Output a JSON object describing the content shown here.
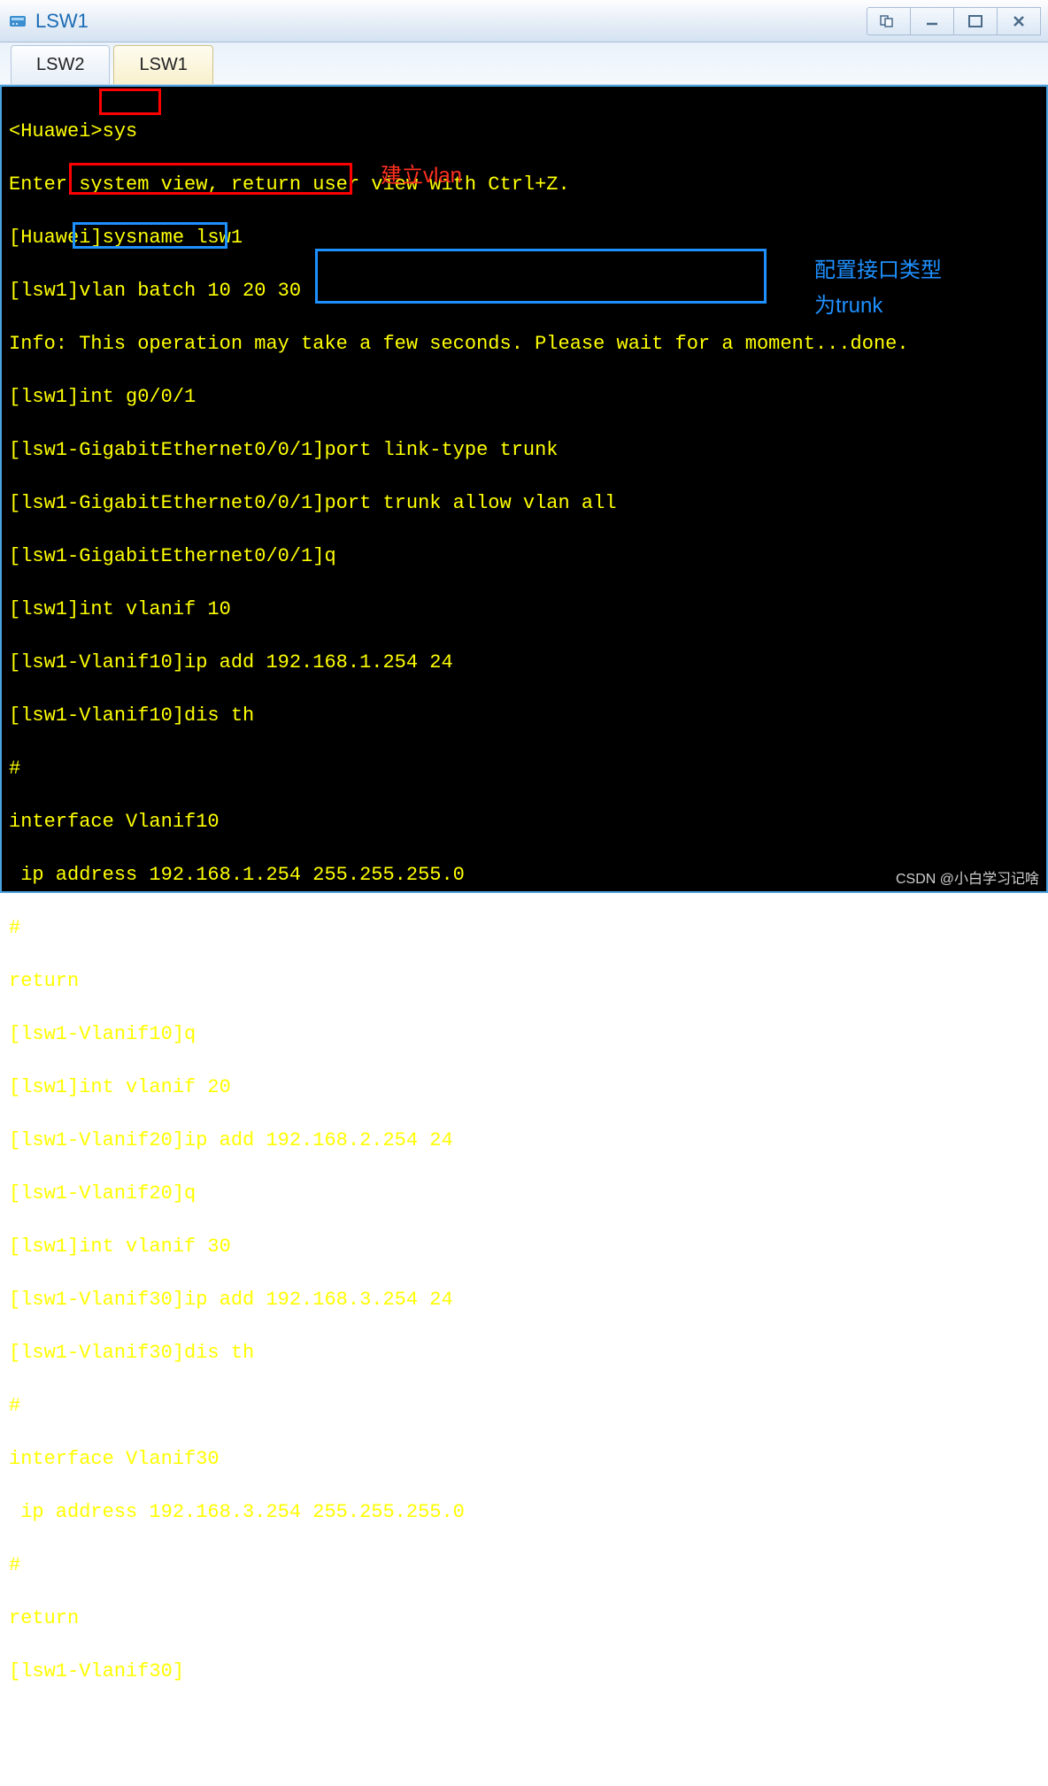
{
  "window": {
    "title": "LSW1"
  },
  "tabs": [
    {
      "label": "LSW2",
      "active": false
    },
    {
      "label": "LSW1",
      "active": true
    }
  ],
  "annotations": {
    "vlan_label": "建立vlan",
    "trunk_label_line1": "配置接口类型",
    "trunk_label_line2": "为trunk"
  },
  "terminal_lines": {
    "l0": "<Huawei>sys",
    "l1": "Enter system view, return user view with Ctrl+Z.",
    "l2": "[Huawei]sysname lsw1",
    "l3": "[lsw1]vlan batch 10 20 30",
    "l4": "Info: This operation may take a few seconds. Please wait for a moment...done.",
    "l5": "[lsw1]int g0/0/1",
    "l6": "[lsw1-GigabitEthernet0/0/1]port link-type trunk",
    "l7": "[lsw1-GigabitEthernet0/0/1]port trunk allow vlan all",
    "l8": "[lsw1-GigabitEthernet0/0/1]q",
    "l9": "[lsw1]int vlanif 10",
    "l10": "[lsw1-Vlanif10]ip add 192.168.1.254 24",
    "l11": "[lsw1-Vlanif10]dis th",
    "l12": "#",
    "l13": "interface Vlanif10",
    "l14": " ip address 192.168.1.254 255.255.255.0",
    "l15": "#",
    "l16": "return",
    "l17": "[lsw1-Vlanif10]q",
    "l18": "[lsw1]int vlanif 20",
    "l19": "[lsw1-Vlanif20]ip add 192.168.2.254 24",
    "l20": "[lsw1-Vlanif20]q",
    "l21": "[lsw1]int vlanif 30",
    "l22": "[lsw1-Vlanif30]ip add 192.168.3.254 24",
    "l23": "[lsw1-Vlanif30]dis th",
    "l24": "#",
    "l25": "interface Vlanif30",
    "l26": " ip address 192.168.3.254 255.255.255.0",
    "l27": "#",
    "l28": "return",
    "l29": "[lsw1-Vlanif30]"
  },
  "watermark": "CSDN @小白学习记啥"
}
